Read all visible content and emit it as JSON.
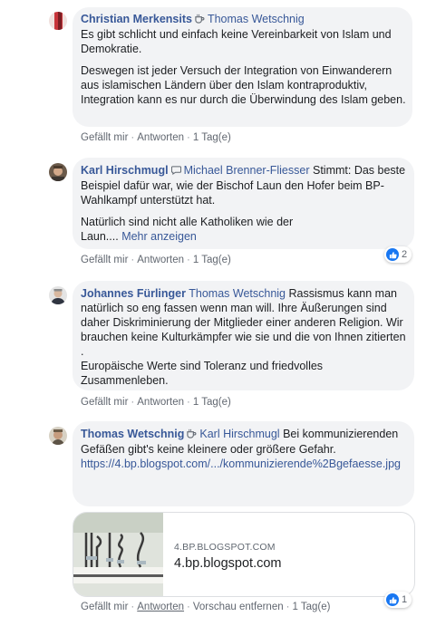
{
  "colors": {
    "link": "#385898",
    "bubble": "#f2f3f5",
    "meta": "#616770",
    "like": "#1877f2"
  },
  "comments": [
    {
      "author": "Christian Merkensits",
      "author_icon": "coffee-icon",
      "mention": "Thomas Wetschnig",
      "p1": "Es gibt schlicht und einfach keine Vereinbarkeit von Islam und Demokratie.",
      "p2": "Deswegen ist jeder Versuch der Integration von Einwanderern aus islamischen Ländern über den Islam kontraproduktiv, Integration kann es nur durch die Überwindung des Islam geben.",
      "like_label": "Gefällt mir",
      "reply_label": "Antworten",
      "time": "1 Tag(e)"
    },
    {
      "author": "Karl Hirschmugl",
      "author_icon": "chat-bubble-icon",
      "mention": "Michael Brenner-Fliesser",
      "p1": "Stimmt: Das beste Beispiel dafür war, wie der Bischof Laun den Hofer beim BP-Wahlkampf unterstützt hat.",
      "p2": "Natürlich sind nicht alle Katholiken wie der Laun....",
      "more_label": "Mehr anzeigen",
      "like_label": "Gefällt mir",
      "reply_label": "Antworten",
      "time": "1 Tag(e)",
      "reactions": "2"
    },
    {
      "author": "Johannes Fürlinger",
      "mention": "Thomas Wetschnig",
      "p1": "Rassismus kann man natürlich so eng fassen wenn man will. Ihre Äußerungen sind daher Diskriminierung der Mitglieder einer anderen Religion. Wir brauchen keine Kulturkämpfer wie sie und die von Ihnen zitierten .",
      "p2": "Europäische Werte sind Toleranz und friedvolles Zusammenleben.",
      "like_label": "Gefällt mir",
      "reply_label": "Antworten",
      "time": "1 Tag(e)"
    },
    {
      "author": "Thomas Wetschnig",
      "author_icon": "coffee-icon",
      "mention": "Karl Hirschmugl",
      "p1": "Bei kommunizierenden Gefäßen gibt's keine kleinere oder größere Gefahr.",
      "url": "https://4.bp.blogspot.com/.../kommunizierende%2Bgefaesse.jpg",
      "card_domain": "4.BP.BLOGSPOT.COM",
      "card_title": "4.bp.blogspot.com",
      "like_label": "Gefällt mir",
      "reply_label": "Antworten",
      "remove_preview_label": "Vorschau entfernen",
      "time": "1 Tag(e)",
      "reactions": "1"
    }
  ]
}
